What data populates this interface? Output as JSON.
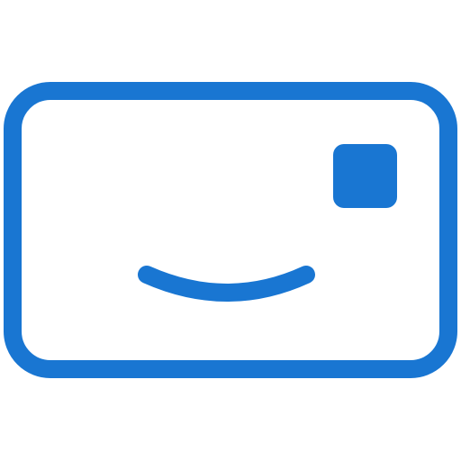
{
  "icon": {
    "name": "smiling-postcard-icon",
    "color": "#1976D2",
    "background": "#FFFFFF"
  }
}
